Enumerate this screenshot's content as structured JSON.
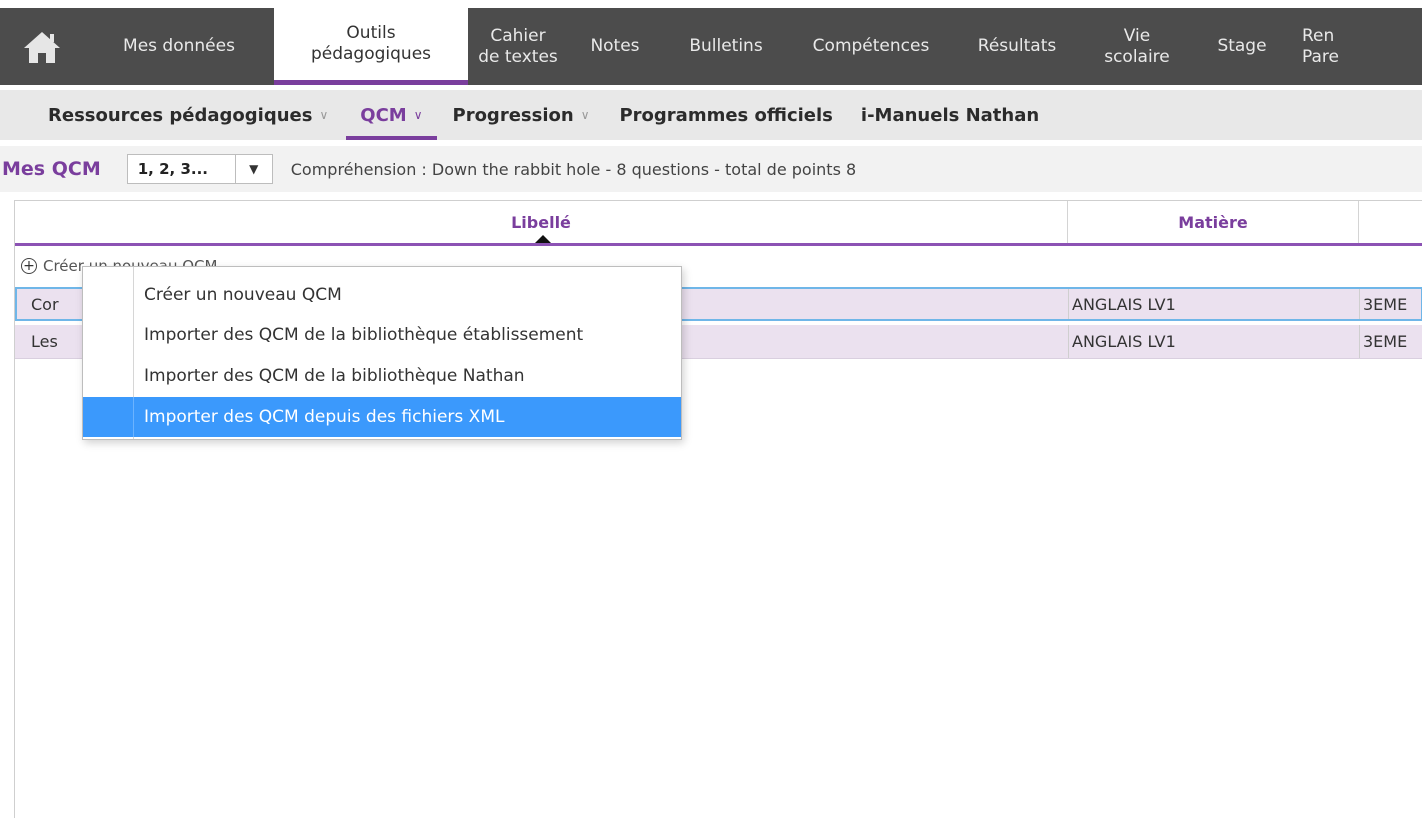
{
  "topnav": {
    "home_icon": "home-icon",
    "items": [
      {
        "label": "Mes données"
      },
      {
        "label": "Outils\npédagogiques",
        "active": true
      },
      {
        "label": "Cahier\nde textes"
      },
      {
        "label": "Notes"
      },
      {
        "label": "Bulletins"
      },
      {
        "label": "Compétences"
      },
      {
        "label": "Résultats"
      },
      {
        "label": "Vie\nscolaire"
      },
      {
        "label": "Stage"
      },
      {
        "label": "Ren\nPare"
      }
    ]
  },
  "subnav": {
    "items": [
      {
        "label": "Ressources pédagogiques",
        "chevron": "∨"
      },
      {
        "label": "QCM",
        "chevron": "∨",
        "active": true
      },
      {
        "label": "Progression",
        "chevron": "∨"
      },
      {
        "label": "Programmes officiels",
        "chevron": ""
      },
      {
        "label": "i-Manuels Nathan",
        "chevron": ""
      }
    ]
  },
  "toolbar": {
    "title": "Mes QCM",
    "combo_value": "1, 2, 3...",
    "summary": "Compréhension : Down the rabbit hole - 8 questions - total de points 8"
  },
  "table": {
    "columns": [
      "Libellé",
      "Matière",
      ""
    ],
    "create_label": "Créer un nouveau QCM",
    "rows": [
      {
        "libelle": "Cor",
        "matiere": "ANGLAIS LV1",
        "classe": "3EME"
      },
      {
        "libelle": "Les",
        "matiere": "ANGLAIS LV1",
        "classe": "3EME"
      }
    ]
  },
  "menu": {
    "items": [
      {
        "label": "Créer un nouveau QCM"
      },
      {
        "label": "Importer des QCM de la bibliothèque établissement"
      },
      {
        "label": "Importer des QCM de la bibliothèque Nathan"
      },
      {
        "label": "Importer des QCM depuis des fichiers XML",
        "selected": true
      }
    ]
  },
  "colors": {
    "accent": "#7a3e9d",
    "topnav_bg": "#4c4c4c",
    "row_bg": "#ebe1ef",
    "selection": "#3b99fc"
  }
}
